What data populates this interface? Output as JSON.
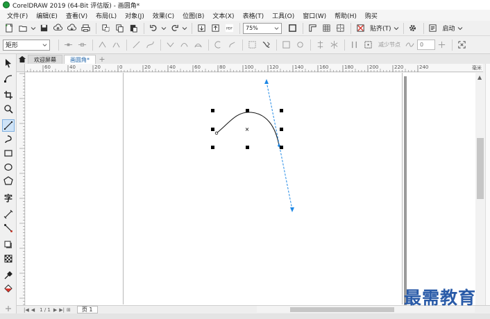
{
  "window": {
    "title": "CorelDRAW 2019 (64-Bit 评估版) - 画圆角*"
  },
  "menu": {
    "items": [
      "文件(F)",
      "编辑(E)",
      "查看(V)",
      "布局(L)",
      "对象(J)",
      "效果(C)",
      "位图(B)",
      "文本(X)",
      "表格(T)",
      "工具(O)",
      "窗口(W)",
      "帮助(H)",
      "购买"
    ]
  },
  "standard_toolbar": {
    "zoom_value": "75%",
    "snap_label": "贴齐(T)",
    "launch_label": "启动",
    "pdf_label": "PDF"
  },
  "property_bar": {
    "shape_type": "矩形",
    "reduce_nodes_label": "减少节点",
    "smoothness_value": "0"
  },
  "tabs": [
    {
      "label": "欢迎屏幕"
    },
    {
      "label": "画圆角*"
    }
  ],
  "ruler": {
    "h_ticks": [
      "60",
      "40",
      "20",
      "0",
      "20",
      "40",
      "60",
      "80",
      "100",
      "120",
      "140",
      "160",
      "180",
      "200",
      "220",
      "240"
    ],
    "unit": "毫米"
  },
  "page_nav": {
    "counter": "1 / 1",
    "page_tab": "页 1"
  },
  "watermark": {
    "text": "最需教育"
  },
  "colors": {
    "accent": "#1e88e5",
    "watermark": "#2a5ba8"
  }
}
